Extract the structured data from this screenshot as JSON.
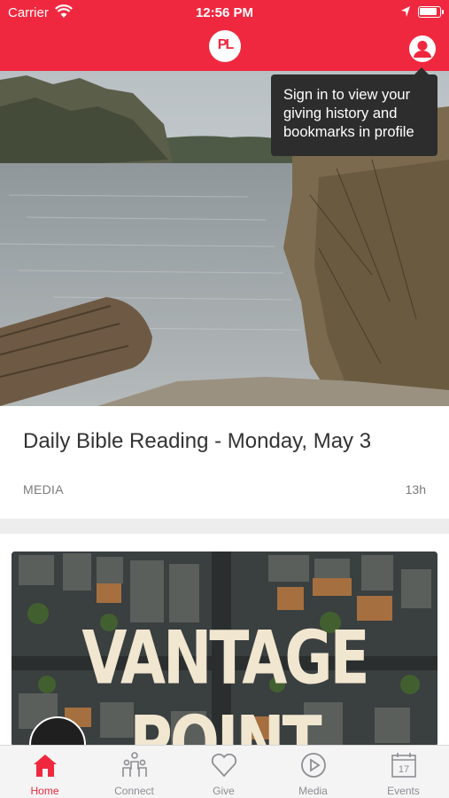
{
  "status_bar": {
    "carrier": "Carrier",
    "time": "12:56 PM"
  },
  "header": {
    "logo_text": "PL"
  },
  "tooltip": {
    "text": "Sign in to view your giving history and bookmarks in profile"
  },
  "feed": [
    {
      "title": "Daily Bible Reading - Monday, May 3",
      "category": "MEDIA",
      "age": "13h"
    },
    {
      "image_title": "VANTAGE POINT"
    }
  ],
  "tabs": [
    {
      "label": "Home",
      "icon": "home-icon",
      "active": true
    },
    {
      "label": "Connect",
      "icon": "connect-icon",
      "active": false
    },
    {
      "label": "Give",
      "icon": "heart-icon",
      "active": false
    },
    {
      "label": "Media",
      "icon": "play-icon",
      "active": false
    },
    {
      "label": "Events",
      "icon": "calendar-icon",
      "active": false
    }
  ],
  "colors": {
    "brand": "#f0283f",
    "inactive_tab": "#8e8e93",
    "tooltip_bg": "#2d2d2d"
  }
}
